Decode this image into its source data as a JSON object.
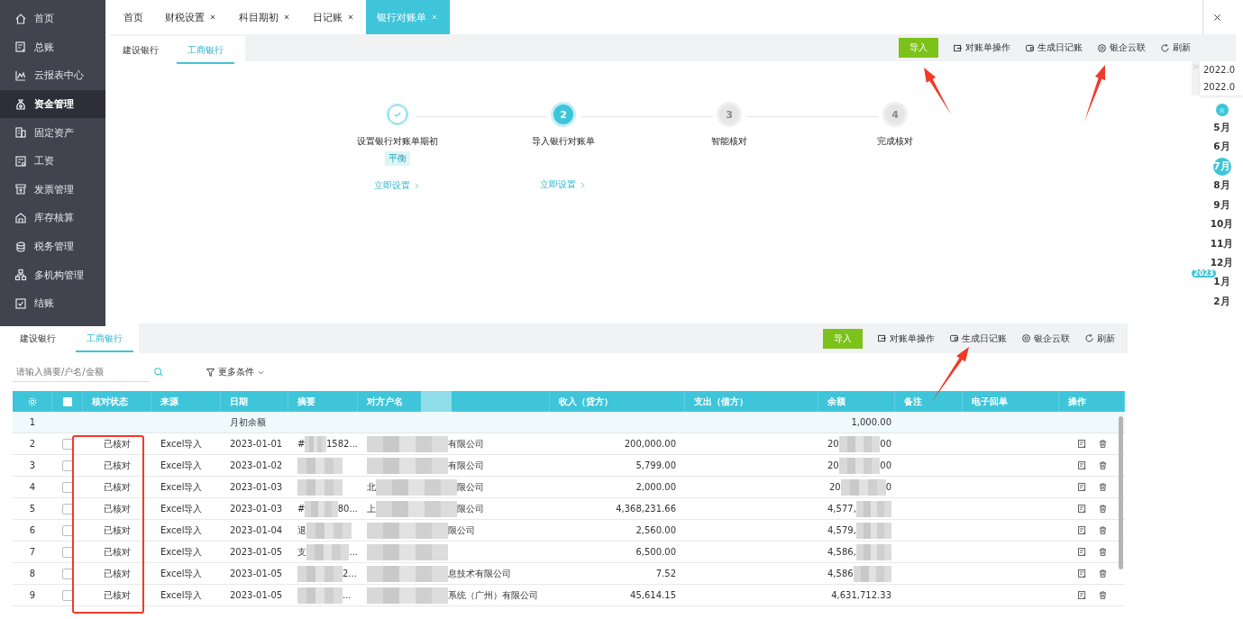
{
  "sidebar": {
    "items": [
      {
        "label": "首页",
        "selected": false
      },
      {
        "label": "总账",
        "selected": false
      },
      {
        "label": "云报表中心",
        "selected": false
      },
      {
        "label": "资金管理",
        "selected": true
      },
      {
        "label": "固定资产",
        "selected": false
      },
      {
        "label": "工资",
        "selected": false
      },
      {
        "label": "发票管理",
        "selected": false
      },
      {
        "label": "库存核算",
        "selected": false
      },
      {
        "label": "税务管理",
        "selected": false
      },
      {
        "label": "多机构管理",
        "selected": false
      },
      {
        "label": "结账",
        "selected": false
      }
    ]
  },
  "tabs": [
    {
      "label": "首页",
      "closable": false,
      "selected": false
    },
    {
      "label": "财税设置",
      "closable": true,
      "selected": false
    },
    {
      "label": "科目期初",
      "closable": true,
      "selected": false
    },
    {
      "label": "日记账",
      "closable": true,
      "selected": false
    },
    {
      "label": "银行对账单",
      "closable": true,
      "selected": true
    }
  ],
  "top_panel": {
    "bank_tabs": [
      {
        "label": "建设银行",
        "selected": false
      },
      {
        "label": "工商银行",
        "selected": true
      }
    ],
    "toolbar": {
      "import": "导入",
      "actions": [
        {
          "label": "对账单操作"
        },
        {
          "label": "生成日记账"
        },
        {
          "label": "银企云联"
        },
        {
          "label": "刷新"
        }
      ]
    },
    "steps": [
      {
        "kind": "done",
        "label": "设置银行对账单期初",
        "badge": "平衡",
        "link": "立即设置"
      },
      {
        "kind": "current",
        "number": "2",
        "label": "导入银行对账单",
        "link": "立即设置"
      },
      {
        "kind": "pending",
        "number": "3",
        "label": "智能核对"
      },
      {
        "kind": "pending",
        "number": "4",
        "label": "完成核对"
      }
    ],
    "month_rail": {
      "dates": [
        "2022.0",
        "2022.0"
      ],
      "months": [
        {
          "label": "5月",
          "selected": false
        },
        {
          "label": "6月",
          "selected": false
        },
        {
          "label": "7月",
          "selected": true
        },
        {
          "label": "8月",
          "selected": false
        },
        {
          "label": "9月",
          "selected": false
        },
        {
          "label": "10月",
          "selected": false
        },
        {
          "label": "11月",
          "selected": false
        },
        {
          "label": "12月",
          "selected": false
        },
        {
          "label": "1月",
          "selected": false,
          "year_badge": "2023"
        },
        {
          "label": "2月",
          "selected": false
        }
      ]
    }
  },
  "bottom_panel": {
    "bank_tabs": [
      {
        "label": "建设银行",
        "selected": false
      },
      {
        "label": "工商银行",
        "selected": true
      }
    ],
    "toolbar": {
      "import": "导入",
      "actions": [
        {
          "label": "对账单操作"
        },
        {
          "label": "生成日记账"
        },
        {
          "label": "银企云联"
        },
        {
          "label": "刷新"
        }
      ]
    },
    "search": {
      "placeholder": "请输入摘要/户名/金额"
    },
    "filter": "更多条件",
    "table": {
      "header_checked": false,
      "columns": [
        {
          "label": "核对状态"
        },
        {
          "label": "来源"
        },
        {
          "label": "日期"
        },
        {
          "label": "摘要"
        },
        {
          "label": "对方户名",
          "blurred": true
        },
        {
          "label": "收入（贷方）"
        },
        {
          "label": "支出（借方）"
        },
        {
          "label": "余额"
        },
        {
          "label": "备注"
        },
        {
          "label": "电子回单"
        },
        {
          "label": "操作"
        }
      ],
      "rows": [
        {
          "kind": "opening",
          "index": "1",
          "date": "月初余额",
          "balance": {
            "before": "1,000.00",
            "blurred": false
          }
        },
        {
          "kind": "entry",
          "index": "2",
          "checked": false,
          "status": "已核对",
          "source": "Excel导入",
          "date": "2023-01-01",
          "summary": {
            "before": "#",
            "blurred": true,
            "after": "1582..."
          },
          "counterparty": {
            "blurred": true,
            "after": "有限公司"
          },
          "income": "200,000.00",
          "balance": {
            "before": "20",
            "blurred": true,
            "after": "00"
          }
        },
        {
          "kind": "entry",
          "index": "3",
          "checked": false,
          "status": "已核对",
          "source": "Excel导入",
          "date": "2023-01-02",
          "summary": {
            "blurred": true
          },
          "counterparty": {
            "blurred": true,
            "after": "有限公司"
          },
          "income": "5,799.00",
          "balance": {
            "before": "20",
            "blurred": true,
            "after": "00"
          }
        },
        {
          "kind": "entry",
          "index": "4",
          "checked": false,
          "status": "已核对",
          "source": "Excel导入",
          "date": "2023-01-03",
          "summary": {
            "blurred": true
          },
          "counterparty": {
            "before": "北",
            "blurred": true,
            "after": "限公司"
          },
          "income": "2,000.00",
          "balance": {
            "before": "20",
            "blurred": true,
            "after": "0"
          }
        },
        {
          "kind": "entry",
          "index": "5",
          "checked": false,
          "status": "已核对",
          "source": "Excel导入",
          "date": "2023-01-03",
          "summary": {
            "before": "#",
            "blurred": true,
            "after": "80..."
          },
          "counterparty": {
            "before": "上",
            "blurred": true,
            "after": "限公司"
          },
          "income": "4,368,231.66",
          "balance": {
            "before": "4,577,",
            "blurred": true
          }
        },
        {
          "kind": "entry",
          "index": "6",
          "checked": false,
          "status": "已核对",
          "source": "Excel导入",
          "date": "2023-01-04",
          "summary": {
            "before": "退",
            "blurred": true
          },
          "counterparty": {
            "blurred": true,
            "after": "限公司"
          },
          "income": "2,560.00",
          "balance": {
            "before": "4,579,",
            "blurred": true
          }
        },
        {
          "kind": "entry",
          "index": "7",
          "checked": false,
          "status": "已核对",
          "source": "Excel导入",
          "date": "2023-01-05",
          "summary": {
            "before": "支",
            "blurred": true,
            "after": "..."
          },
          "counterparty": {
            "blurred": true
          },
          "income": "6,500.00",
          "balance": {
            "before": "4,586,",
            "blurred": true
          }
        },
        {
          "kind": "entry",
          "index": "8",
          "checked": false,
          "status": "已核对",
          "source": "Excel导入",
          "date": "2023-01-05",
          "summary": {
            "blurred": true,
            "after": "2..."
          },
          "counterparty": {
            "blurred": true,
            "after": "息技术有限公司"
          },
          "income": "7.52",
          "balance": {
            "before": "4,586",
            "blurred": true
          }
        },
        {
          "kind": "entry",
          "index": "9",
          "checked": false,
          "status": "已核对",
          "source": "Excel导入",
          "date": "2023-01-05",
          "summary": {
            "blurred": true,
            "after": "..."
          },
          "counterparty": {
            "blurred": true,
            "after": "系统（广州）有限公司"
          },
          "income": "45,614.15",
          "balance": {
            "before": "4,631,712.33",
            "blurred": false
          }
        }
      ]
    }
  }
}
